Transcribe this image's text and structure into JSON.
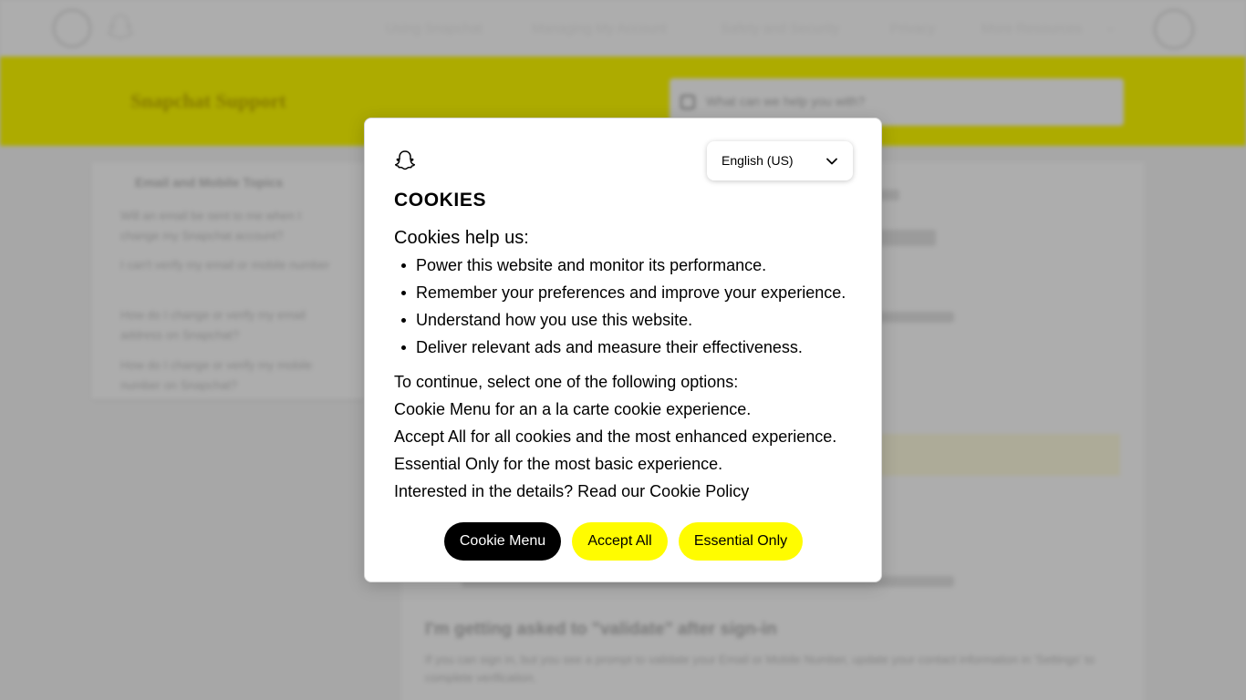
{
  "colors": {
    "brand_yellow": "#fffc00",
    "black": "#000000"
  },
  "background_page": {
    "header": {
      "brand": "Snapchat Support",
      "nav": [
        "Using Snapchat",
        "Managing My Account",
        "Safety and Security",
        "Privacy",
        "More Resources"
      ],
      "icons": [
        "home-icon",
        "ghost-logo-icon",
        "chevron-down-icon",
        "account-avatar-icon"
      ]
    },
    "hero": {
      "title": "Snapchat Support",
      "search_placeholder": "What can we help you with?"
    },
    "sidebar": {
      "heading": "Email and Mobile Topics",
      "items": [
        "Will an email be sent to me when I change my Snapchat account?",
        "I can't verify my email or mobile number",
        "How do I change or verify my email address on Snapchat?",
        "How do I change or verify my mobile number on Snapchat?"
      ]
    },
    "content": {
      "heading": "I'm getting asked to \"validate\" after sign-in",
      "text": "If you can sign in, but you see a prompt to validate your Email or Mobile Number, update your contact information in 'Settings' to complete verification."
    }
  },
  "cookie_dialog": {
    "logo_icon": "snapchat-ghost-icon",
    "language": {
      "selected": "English (US)",
      "icon": "chevron-down-icon"
    },
    "title": "COOKIES",
    "intro": "Cookies help us:",
    "bullets": [
      "Power this website and monitor its performance.",
      "Remember your preferences and improve your experience.",
      "Understand how you use this website.",
      "Deliver relevant ads and measure their effectiveness."
    ],
    "paragraphs": [
      "To continue, select one of the following options:",
      "Cookie Menu for an a la carte cookie experience.",
      "Accept All for all cookies and the most enhanced experience.",
      "Essential Only for the most basic experience.",
      "Interested in the details? Read our Cookie Policy"
    ],
    "buttons": {
      "cookie_menu": "Cookie Menu",
      "accept_all": "Accept All",
      "essential_only": "Essential Only"
    }
  }
}
